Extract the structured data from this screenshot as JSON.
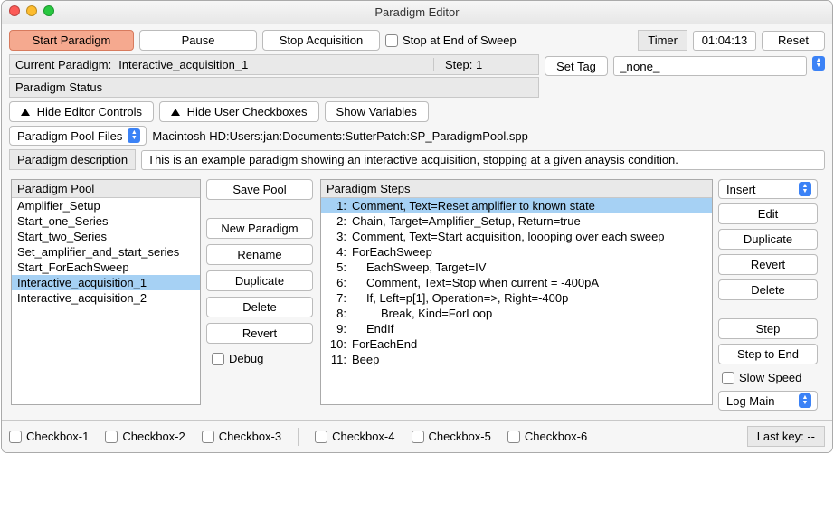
{
  "window": {
    "title": "Paradigm Editor"
  },
  "toolbar": {
    "start": "Start Paradigm",
    "pause": "Pause",
    "stop_acq": "Stop Acquisition",
    "stop_end_sweep": "Stop at End of Sweep",
    "timer_label": "Timer",
    "timer_value": "01:04:13",
    "reset": "Reset"
  },
  "statusbar": {
    "current_paradigm_label": "Current Paradigm:",
    "current_paradigm_value": "Interactive_acquisition_1",
    "step_label": "Step: 1",
    "paradigm_status_label": "Paradigm Status",
    "set_tag_btn": "Set Tag",
    "tag_value": "_none_"
  },
  "view_controls": {
    "hide_editor": "Hide Editor Controls",
    "hide_user": "Hide User Checkboxes",
    "show_vars": "Show Variables"
  },
  "pool_path": {
    "selector": "Paradigm Pool Files",
    "path": "Macintosh HD:Users:jan:Documents:SutterPatch:SP_ParadigmPool.spp"
  },
  "description": {
    "label": "Paradigm description",
    "value": "This is an example paradigm showing an interactive acquisition, stopping at a given anaysis condition."
  },
  "pool": {
    "header": "Paradigm Pool",
    "items": [
      "Amplifier_Setup",
      "Start_one_Series",
      "Start_two_Series",
      "Set_amplifier_and_start_series",
      "Start_ForEachSweep",
      "Interactive_acquisition_1",
      "Interactive_acquisition_2"
    ],
    "selected_index": 5
  },
  "pool_buttons": {
    "save": "Save Pool",
    "new_paradigm": "New Paradigm",
    "rename": "Rename",
    "duplicate": "Duplicate",
    "delete": "Delete",
    "revert": "Revert",
    "debug": "Debug"
  },
  "steps": {
    "header": "Paradigm Steps",
    "rows": [
      {
        "n": "1:",
        "text": "Comment, Text=Reset amplifier to known state",
        "indent": 0,
        "selected": true
      },
      {
        "n": "2:",
        "text": "Chain, Target=Amplifier_Setup, Return=true",
        "indent": 0
      },
      {
        "n": "3:",
        "text": "Comment, Text=Start acquisition, loooping over each sweep",
        "indent": 0
      },
      {
        "n": "4:",
        "text": "ForEachSweep",
        "indent": 0
      },
      {
        "n": "5:",
        "text": "EachSweep, Target=IV",
        "indent": 1
      },
      {
        "n": "6:",
        "text": "Comment, Text=Stop when current = -400pA",
        "indent": 1
      },
      {
        "n": "7:",
        "text": "If, Left=p[1], Operation=>, Right=-400p",
        "indent": 1
      },
      {
        "n": "8:",
        "text": "Break, Kind=ForLoop",
        "indent": 2
      },
      {
        "n": "9:",
        "text": "EndIf",
        "indent": 1
      },
      {
        "n": "10:",
        "text": "ForEachEnd",
        "indent": 0
      },
      {
        "n": "11:",
        "text": "Beep",
        "indent": 0
      }
    ]
  },
  "step_buttons": {
    "insert": "Insert",
    "edit": "Edit",
    "duplicate": "Duplicate",
    "revert": "Revert",
    "delete": "Delete",
    "step": "Step",
    "step_to_end": "Step to End",
    "slow_speed": "Slow Speed",
    "log_main": "Log Main"
  },
  "bottom": {
    "cb1": "Checkbox-1",
    "cb2": "Checkbox-2",
    "cb3": "Checkbox-3",
    "cb4": "Checkbox-4",
    "cb5": "Checkbox-5",
    "cb6": "Checkbox-6",
    "lastkey": "Last key: --"
  }
}
